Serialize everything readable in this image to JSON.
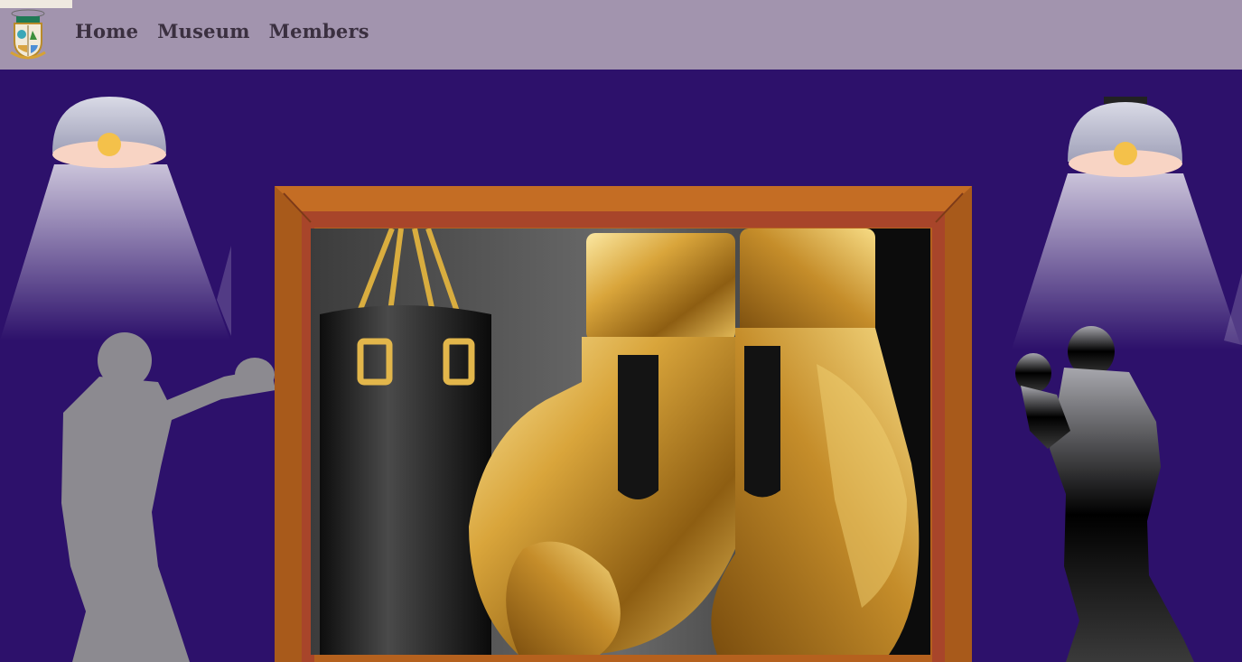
{
  "header": {
    "logo_icon": "club-crest-logo-icon",
    "nav": [
      {
        "label": "Home"
      },
      {
        "label": "Museum"
      },
      {
        "label": "Members"
      }
    ]
  },
  "scene": {
    "left_figure_icon": "boxer-silhouette-punching-icon",
    "right_figure_icon": "boxer-silhouette-guard-icon",
    "lamp_icon": "ceiling-lamp-icon",
    "artwork_icon": "golden-boxing-gloves-painting"
  },
  "colors": {
    "background": "#2d116b",
    "header": "#a294ae",
    "frame": "#b5611e",
    "frame_inner": "#a8452a",
    "nav_text": "#3b3040"
  }
}
